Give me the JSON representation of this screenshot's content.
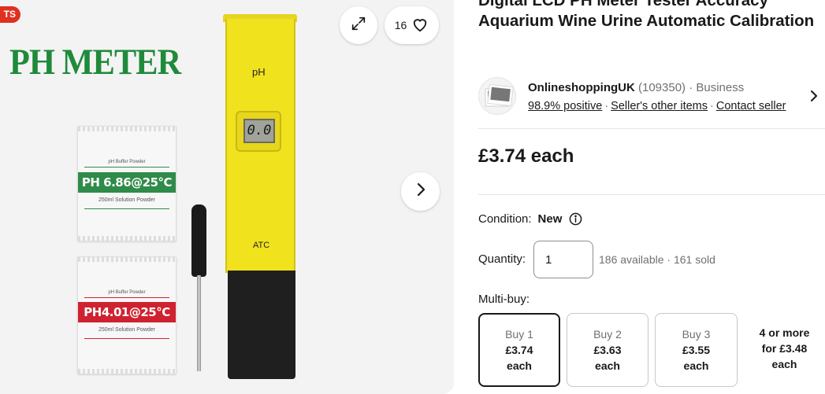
{
  "gallery": {
    "badge": "TS",
    "product_banner": "PH METER",
    "sachets": [
      {
        "small": "pH Buffer Powder",
        "band": "PH 6.86@25°C",
        "sub": "250ml Solution Powder",
        "color": "#2f8b4a"
      },
      {
        "small": "pH Buffer Powder",
        "band": "PH4.01@25°C",
        "sub": "250ml Solution Powder",
        "color": "#cf2230"
      }
    ],
    "meter": {
      "label_top": "pH",
      "display": "0.0",
      "label_bottom": "ATC"
    },
    "watch_count": "16",
    "icons": {
      "expand": "expand-icon",
      "watch": "heart-icon",
      "next": "chevron-right-icon"
    }
  },
  "listing": {
    "title": "Digital LCD PH Meter Tester Accuracy Aquarium Wine Urine Automatic Calibration",
    "seller": {
      "name": "OnlineshoppingUK",
      "feedback_count": "(109350)",
      "type": "· Business",
      "positive": "98.9% positive",
      "other_items": "Seller's other items",
      "contact": "Contact seller"
    },
    "price": "£3.74 each",
    "condition_label": "Condition:",
    "condition_value": "New",
    "quantity_label": "Quantity:",
    "quantity_value": "1",
    "availability": "186 available · 161 sold",
    "multibuy_label": "Multi-buy:",
    "tiers": [
      {
        "line1": "Buy 1",
        "line2": "£3.74",
        "line3": "each",
        "selected": true
      },
      {
        "line1": "Buy 2",
        "line2": "£3.63",
        "line3": "each",
        "selected": false
      },
      {
        "line1": "Buy 3",
        "line2": "£3.55",
        "line3": "each",
        "selected": false
      },
      {
        "line1": "4 or more",
        "line2": "for £3.48",
        "line3": "each",
        "selected": false
      }
    ]
  }
}
